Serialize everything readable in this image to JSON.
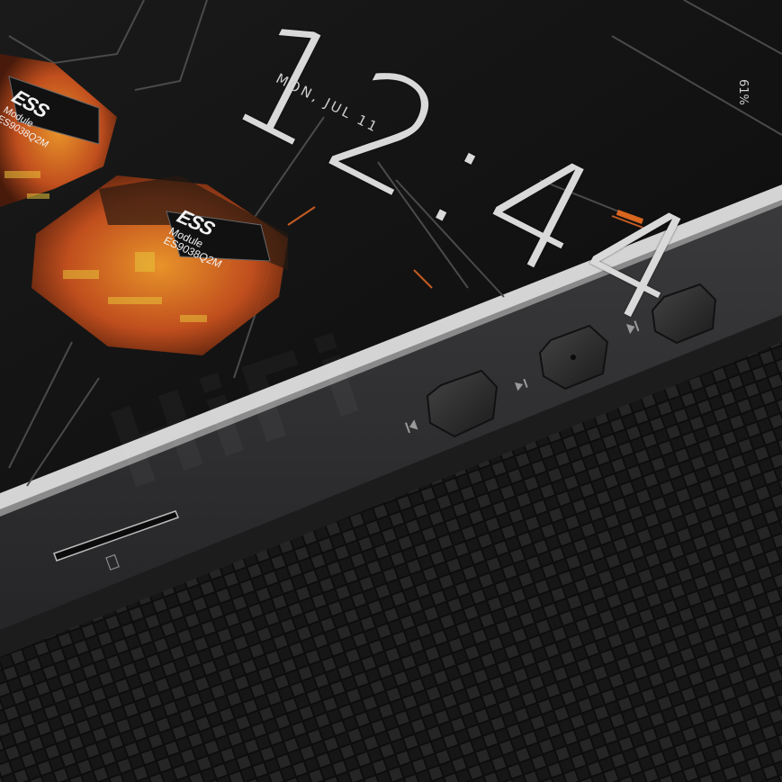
{
  "lockscreen": {
    "time": "12:44",
    "date": "MON, JUL 11",
    "battery": "61%"
  },
  "chips": [
    {
      "brand": "ESS",
      "line1": "Module",
      "line2": "ES9038Q2M"
    },
    {
      "brand": "ESS",
      "line1": "Module",
      "line2": "ES9038Q2M"
    }
  ],
  "colors": {
    "device_body": "#2b2b2d",
    "bezel_edge": "#d6d6d6",
    "screen": "#111111",
    "chip_glow": "#e0702a",
    "carbon_fiber": "#1e1e1e"
  },
  "icons": [
    "next-track-icon",
    "play-pause-icon",
    "previous-track-icon",
    "micro-sd-slot-icon"
  ]
}
